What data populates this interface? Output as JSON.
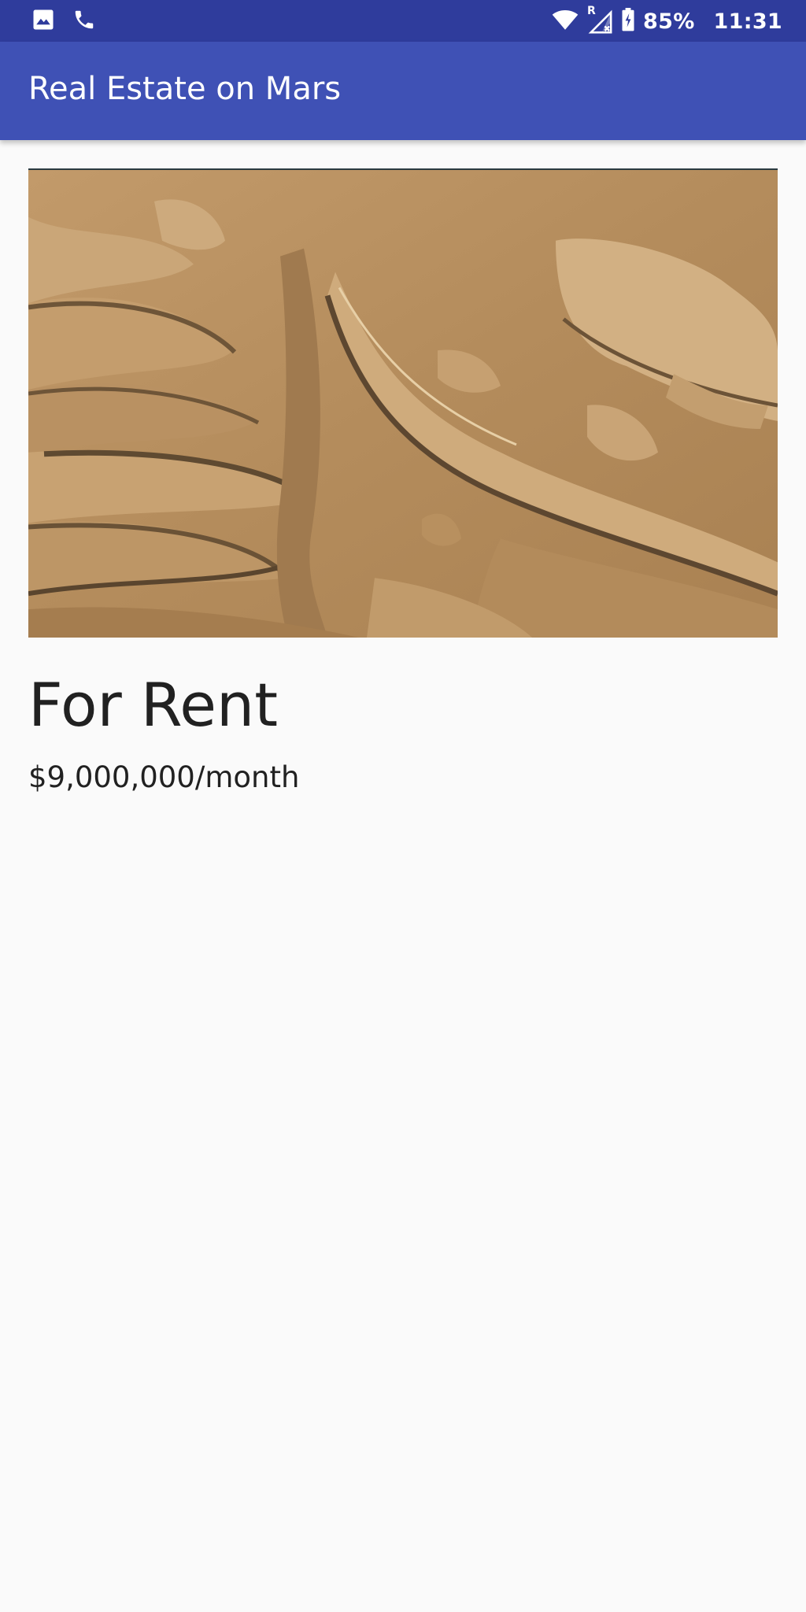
{
  "status_bar": {
    "notification_icons": [
      "image-icon",
      "phone-icon"
    ],
    "system_icons": [
      "wifi-icon",
      "roaming-indicator-icon",
      "no-signal-icon",
      "battery-charging-icon"
    ],
    "roaming_letter": "R",
    "battery_percent": "85%",
    "time": "11:31"
  },
  "app_bar": {
    "title": "Real Estate on Mars"
  },
  "listing": {
    "photo_alt": "Mars surface photo",
    "type": "For Rent",
    "price": "$9,000,000/month"
  },
  "colors": {
    "status_bar": "#2f3c9c",
    "app_bar": "#3f51b5",
    "background": "#fafafa",
    "text_primary": "#212121"
  }
}
